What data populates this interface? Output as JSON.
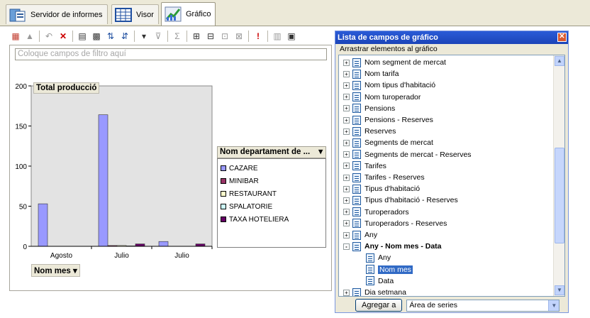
{
  "tabs": [
    {
      "label": "Servidor de informes"
    },
    {
      "label": "Visor"
    },
    {
      "label": "Gráfico"
    }
  ],
  "toolbar_icons": [
    "pivot-icon",
    "chart-type-icon",
    "undo-icon",
    "delete-icon",
    "field-list-icon",
    "fields-icon",
    "sort-asc-icon",
    "sort-desc-icon",
    "autofilter-icon",
    "filter-icon",
    "autocalc-icon",
    "expand-icon",
    "collapse-icon",
    "hide-details-icon",
    "show-details-icon",
    "error-icon",
    "export-icon",
    "properties-icon"
  ],
  "filter_placeholder": "Coloque campos de filtro aquí",
  "chart_data": {
    "type": "bar",
    "title": "Total producció",
    "categories": [
      "Agosto",
      "Julio",
      "Julio"
    ],
    "ylim": [
      0,
      200
    ],
    "yticks": [
      0,
      50,
      100,
      150,
      200
    ],
    "series": [
      {
        "name": "CAZARE",
        "color": "#9999ff",
        "values": [
          53,
          164,
          6
        ]
      },
      {
        "name": "MINIBAR",
        "color": "#993366",
        "values": [
          0,
          1,
          0
        ]
      },
      {
        "name": "RESTAURANT",
        "color": "#ffffcc",
        "values": [
          0,
          1,
          0
        ]
      },
      {
        "name": "SPALATORIE",
        "color": "#ccffff",
        "values": [
          0,
          0.5,
          0
        ]
      },
      {
        "name": "TAXA HOTELIERA",
        "color": "#660066",
        "values": [
          0,
          3,
          3
        ]
      }
    ],
    "legend_title": "Nom departament de ...",
    "xfield": "Nom mes"
  },
  "panel": {
    "title": "Lista de campos de gráfico",
    "subtitle": "Arrastrar elementos al gráfico",
    "items": [
      {
        "label": "Nom segment de mercat",
        "expander": "+"
      },
      {
        "label": "Nom tarifa",
        "expander": "+"
      },
      {
        "label": "Nom tipus d'habitació",
        "expander": "+"
      },
      {
        "label": "Nom turoperador",
        "expander": "+"
      },
      {
        "label": "Pensions",
        "expander": "+"
      },
      {
        "label": "Pensions - Reserves",
        "expander": "+"
      },
      {
        "label": "Reserves",
        "expander": "+"
      },
      {
        "label": "Segments de mercat",
        "expander": "+"
      },
      {
        "label": "Segments de mercat - Reserves",
        "expander": "+"
      },
      {
        "label": "Tarifes",
        "expander": "+"
      },
      {
        "label": "Tarifes - Reserves",
        "expander": "+"
      },
      {
        "label": "Tipus d'habitació",
        "expander": "+"
      },
      {
        "label": "Tipus d'habitació - Reserves",
        "expander": "+"
      },
      {
        "label": "Turoperadors",
        "expander": "+"
      },
      {
        "label": "Turoperadors - Reserves",
        "expander": "+"
      },
      {
        "label": "Any",
        "expander": "+"
      },
      {
        "label": "Any - Nom mes - Data",
        "expander": "-",
        "bold": true
      },
      {
        "label": "Any",
        "child": true
      },
      {
        "label": "Nom mes",
        "child": true,
        "selected": true
      },
      {
        "label": "Data",
        "child": true
      },
      {
        "label": "Dia setmana",
        "expander": "+"
      }
    ],
    "add_button": "Agregar a",
    "area_select": "Área de series"
  }
}
